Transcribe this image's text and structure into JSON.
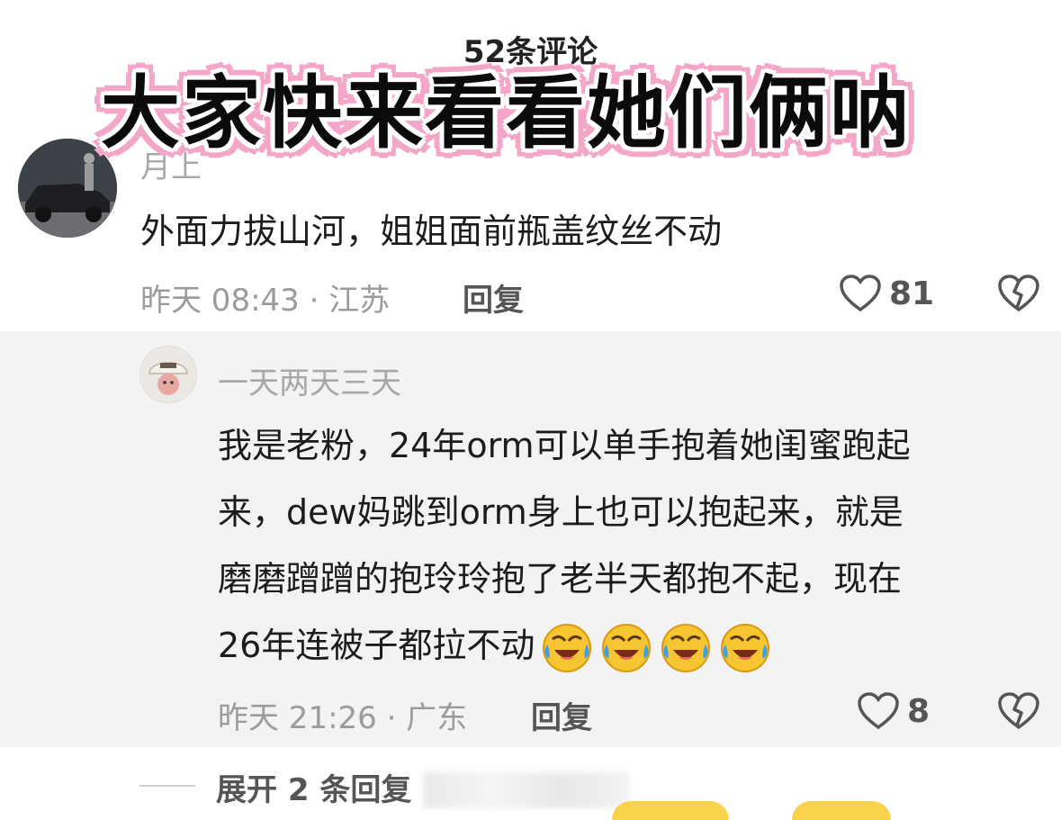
{
  "header": {
    "comment_count": "52条评论"
  },
  "banner": {
    "text": "大家快来看看她们俩呐"
  },
  "comment": {
    "username": "月上",
    "text": "外面力拔山河，姐姐面前瓶盖纹丝不动",
    "time_location": "昨天 08:43 · 江苏",
    "reply_label": "回复",
    "like_count": "81",
    "avatar_icon": "avatar-photo-car",
    "like_icon": "heart-icon",
    "dislike_icon": "broken-heart-icon"
  },
  "reply": {
    "username": "一天两天三天",
    "text_lines": [
      "我是老粉，24年orm可以单手抱着她闺蜜跑起",
      "来，dew妈跳到orm身上也可以抱起来，就是",
      "磨磨蹭蹭的抱玲玲抱了老半天都抱不起，现在",
      "26年连被子都拉不动"
    ],
    "emoji_count": 4,
    "emoji_icon": "rolling-laughing-emoji",
    "time_location": "昨天 21:26 · 广东",
    "reply_label": "回复",
    "like_count": "8",
    "panel_color": "#f3f3f3"
  },
  "expand": {
    "label": "展开 2 条回复"
  },
  "colors": {
    "banner_outline": "#f3a6c8",
    "meta_gray": "#9b9b9b",
    "accent_yellow": "#f7d24a"
  }
}
